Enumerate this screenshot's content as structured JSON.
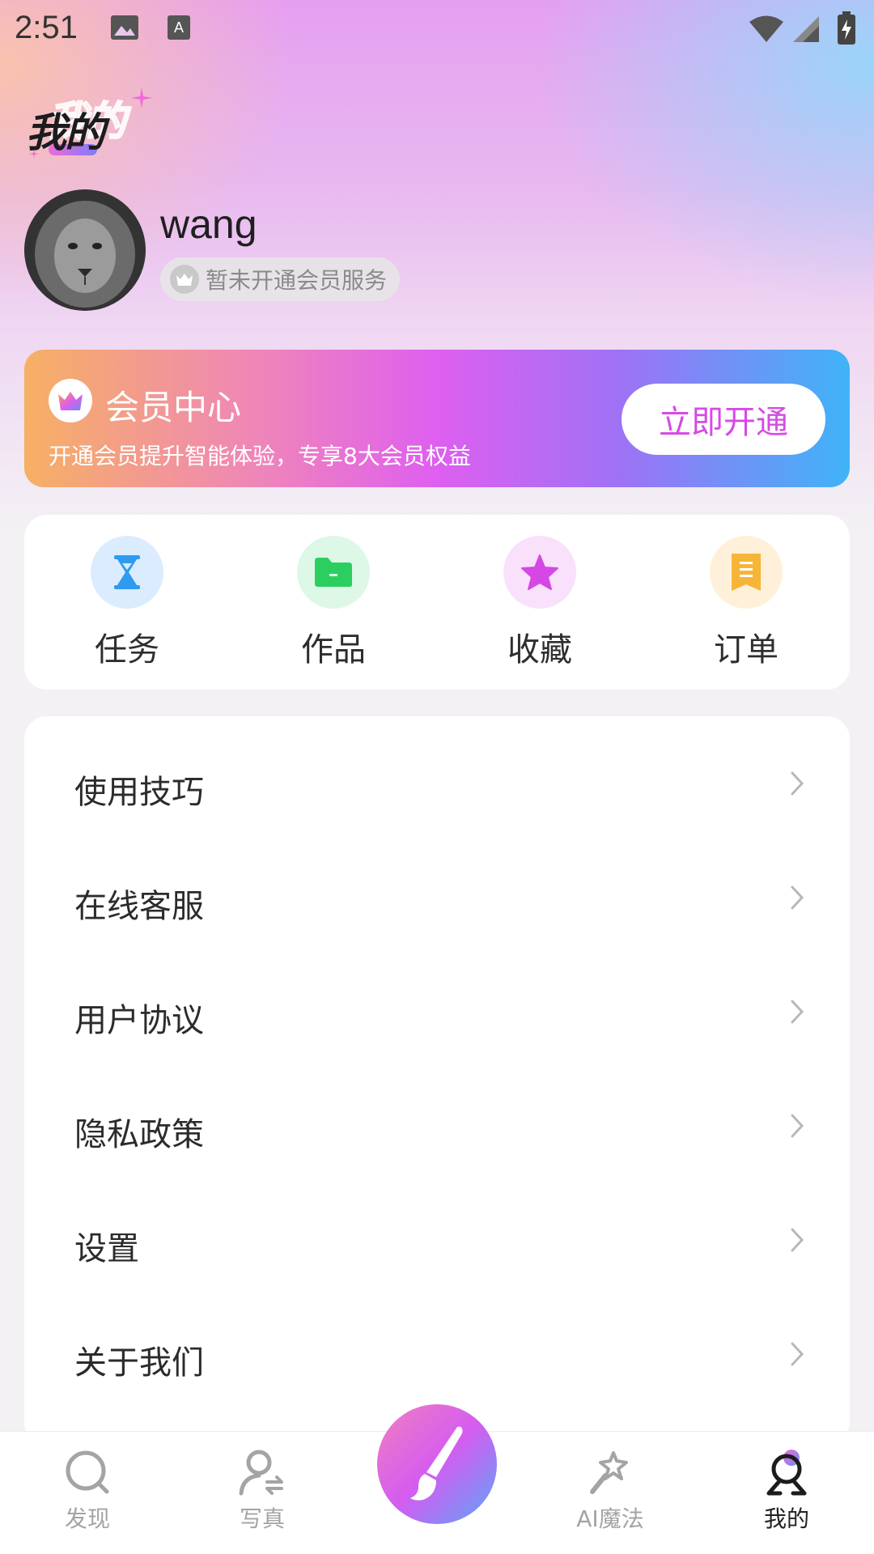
{
  "status_bar": {
    "time": "2:51"
  },
  "header": {
    "title": "我的"
  },
  "profile": {
    "username": "wang",
    "vip_status": "暂未开通会员服务"
  },
  "member_card": {
    "title": "会员中心",
    "subtitle": "开通会员提升智能体验，专享8大会员权益",
    "button_label": "立即开通"
  },
  "quick_actions": [
    {
      "label": "任务",
      "icon": "hourglass-icon",
      "color": "#2f9bf0",
      "bg": "#dcecff"
    },
    {
      "label": "作品",
      "icon": "folder-icon",
      "color": "#2ccf5f",
      "bg": "#ddf8e6"
    },
    {
      "label": "收藏",
      "icon": "star-icon",
      "color": "#d548e6",
      "bg": "#f9e1fb"
    },
    {
      "label": "订单",
      "icon": "receipt-icon",
      "color": "#f7b537",
      "bg": "#fff0d9"
    }
  ],
  "menu": [
    {
      "label": "使用技巧"
    },
    {
      "label": "在线客服"
    },
    {
      "label": "用户协议"
    },
    {
      "label": "隐私政策"
    },
    {
      "label": "设置"
    },
    {
      "label": "关于我们"
    }
  ],
  "bottom_nav": [
    {
      "label": "发现",
      "icon": "search-icon",
      "active": false
    },
    {
      "label": "写真",
      "icon": "person-icon",
      "active": false
    },
    {
      "label": "AI魔法",
      "icon": "magic-wand-icon",
      "active": false
    },
    {
      "label": "我的",
      "icon": "profile-icon",
      "active": true
    }
  ],
  "colors": {
    "accent": "#d64be4",
    "card_start": "#f6b063",
    "card_end": "#3fb3f8"
  }
}
